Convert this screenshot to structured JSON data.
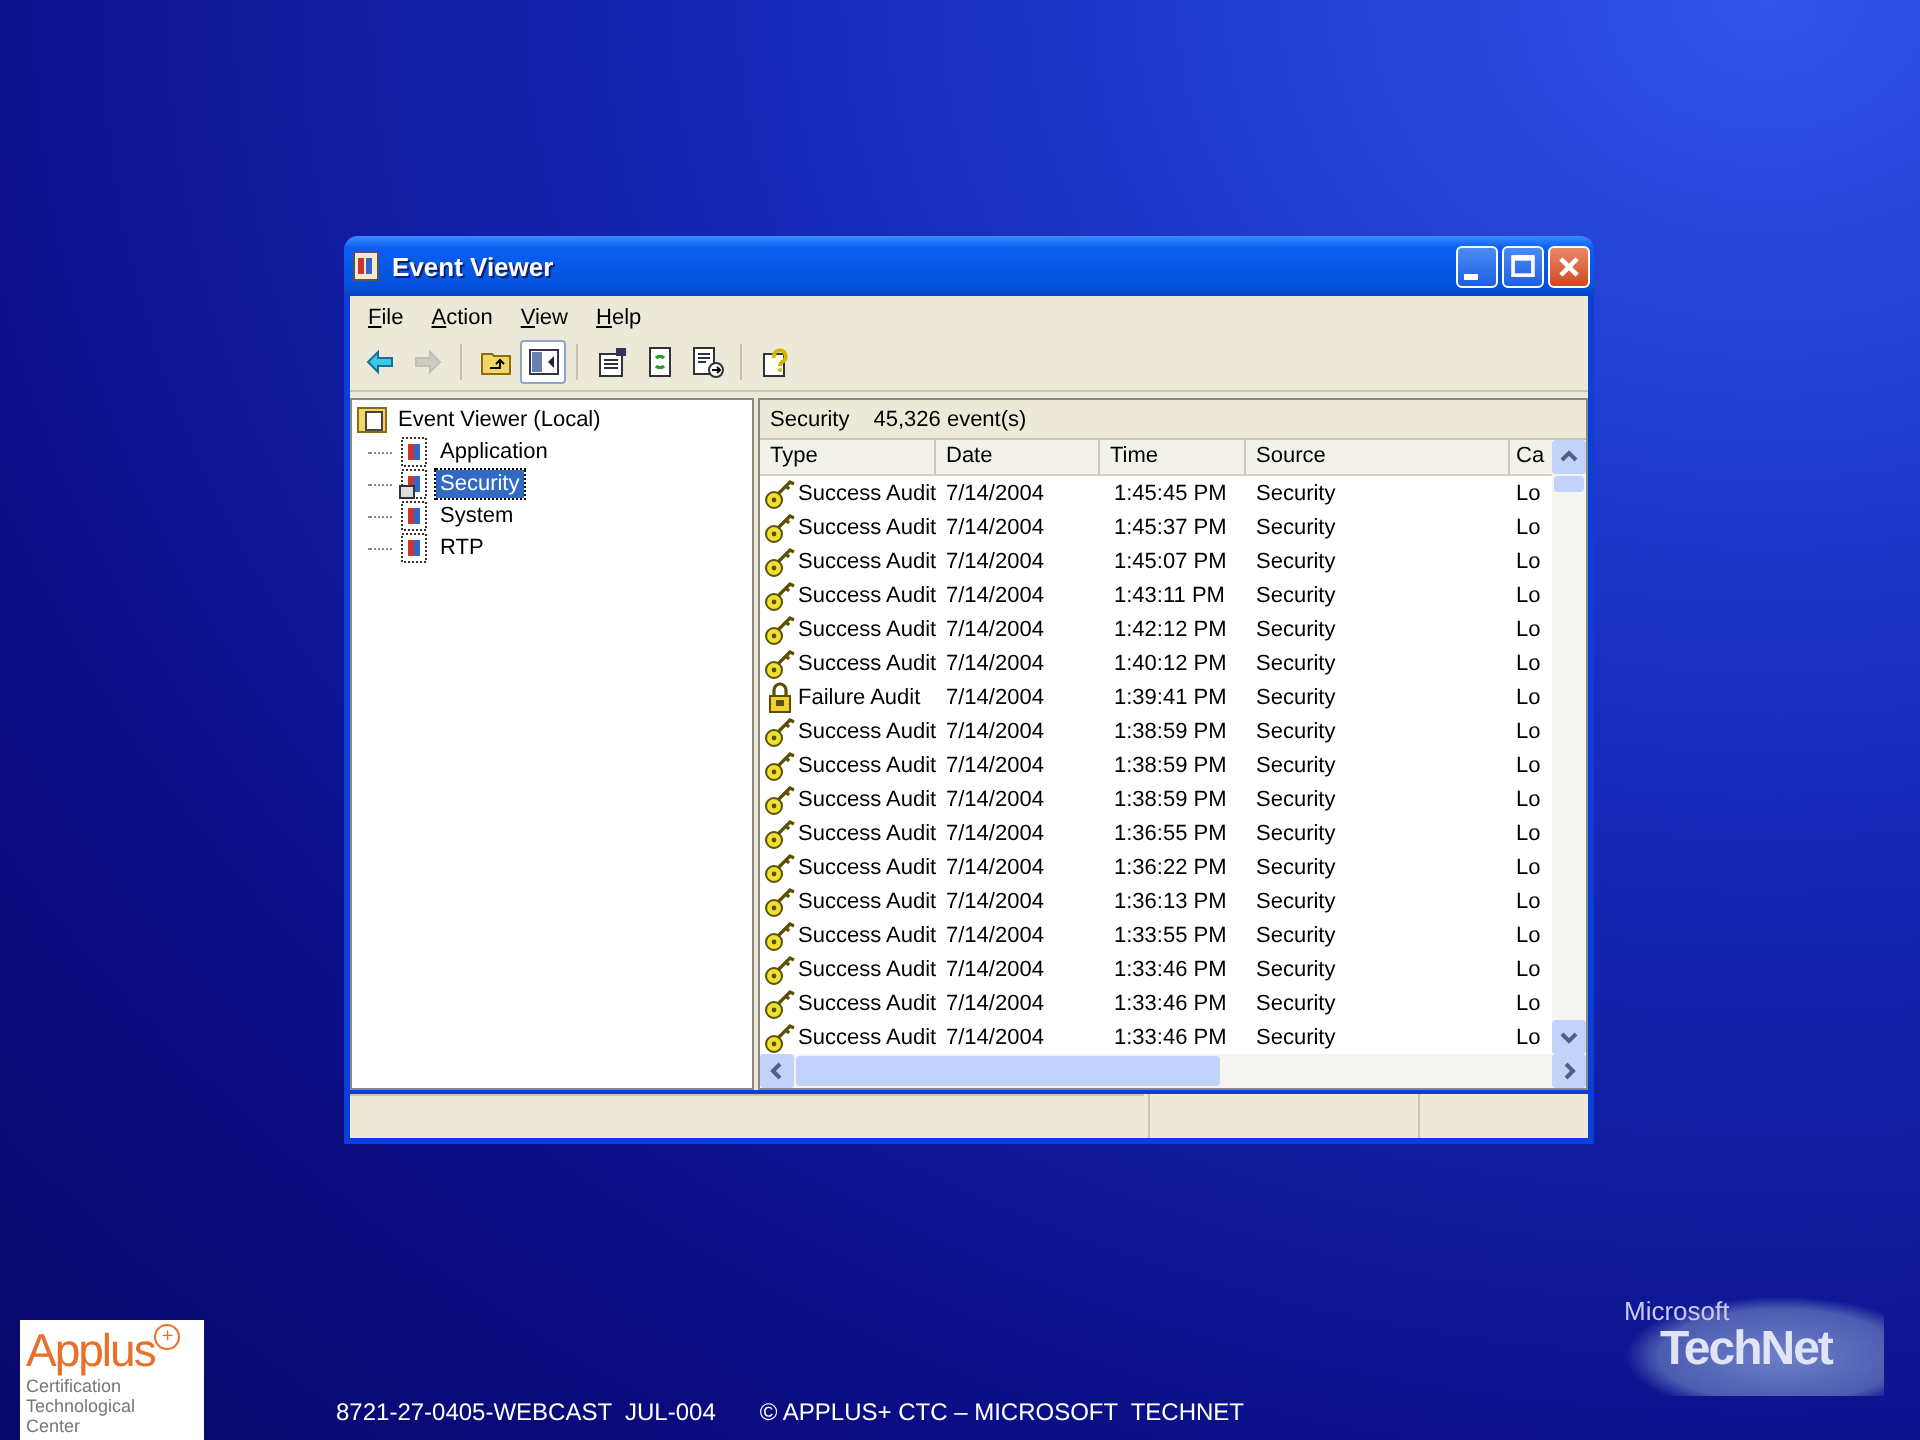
{
  "slide": {
    "footer_code": "8721-27-0405-WEBCAST  JUL-004",
    "footer_copyright": "© APPLUS+ CTC – MICROSOFT  TECHNET",
    "left_logo": {
      "name": "Applus",
      "plus": "+",
      "caption": "Certification Technological Center"
    },
    "right_logo": {
      "top": "Microsoft",
      "bottom": "TechNet"
    }
  },
  "window": {
    "title": "Event Viewer",
    "menu": [
      "File",
      "Action",
      "View",
      "Help"
    ],
    "toolbar": [
      {
        "kind": "back",
        "disabled": false,
        "pressed": false
      },
      {
        "kind": "forward",
        "disabled": true,
        "pressed": false
      },
      {
        "kind": "separator"
      },
      {
        "kind": "up",
        "disabled": false,
        "pressed": false
      },
      {
        "kind": "tree",
        "disabled": false,
        "pressed": true
      },
      {
        "kind": "separator"
      },
      {
        "kind": "properties",
        "disabled": false,
        "pressed": false
      },
      {
        "kind": "refresh",
        "disabled": false,
        "pressed": false
      },
      {
        "kind": "export",
        "disabled": false,
        "pressed": false
      },
      {
        "kind": "separator"
      },
      {
        "kind": "help",
        "disabled": false,
        "pressed": false
      }
    ],
    "tree": {
      "label": "Event Viewer (Local)",
      "expanded": true,
      "children": [
        {
          "label": "Application",
          "selected": false
        },
        {
          "label": "Security",
          "selected": true
        },
        {
          "label": "System",
          "selected": false
        },
        {
          "label": "RTP",
          "selected": false
        }
      ]
    },
    "list_header": {
      "log": "Security",
      "count": "45,326 event(s)"
    },
    "table": {
      "columns": [
        "Type",
        "Date",
        "Time",
        "Source",
        "Ca"
      ],
      "rows": [
        {
          "kind": "success",
          "type": "Success Audit",
          "date": "7/14/2004",
          "time": "1:45:45 PM",
          "source": "Security",
          "category": "Lo"
        },
        {
          "kind": "success",
          "type": "Success Audit",
          "date": "7/14/2004",
          "time": "1:45:37 PM",
          "source": "Security",
          "category": "Lo"
        },
        {
          "kind": "success",
          "type": "Success Audit",
          "date": "7/14/2004",
          "time": "1:45:07 PM",
          "source": "Security",
          "category": "Lo"
        },
        {
          "kind": "success",
          "type": "Success Audit",
          "date": "7/14/2004",
          "time": "1:43:11 PM",
          "source": "Security",
          "category": "Lo"
        },
        {
          "kind": "success",
          "type": "Success Audit",
          "date": "7/14/2004",
          "time": "1:42:12 PM",
          "source": "Security",
          "category": "Lo"
        },
        {
          "kind": "success",
          "type": "Success Audit",
          "date": "7/14/2004",
          "time": "1:40:12 PM",
          "source": "Security",
          "category": "Lo"
        },
        {
          "kind": "failure",
          "type": "Failure Audit",
          "date": "7/14/2004",
          "time": "1:39:41 PM",
          "source": "Security",
          "category": "Lo"
        },
        {
          "kind": "success",
          "type": "Success Audit",
          "date": "7/14/2004",
          "time": "1:38:59 PM",
          "source": "Security",
          "category": "Lo"
        },
        {
          "kind": "success",
          "type": "Success Audit",
          "date": "7/14/2004",
          "time": "1:38:59 PM",
          "source": "Security",
          "category": "Lo"
        },
        {
          "kind": "success",
          "type": "Success Audit",
          "date": "7/14/2004",
          "time": "1:38:59 PM",
          "source": "Security",
          "category": "Lo"
        },
        {
          "kind": "success",
          "type": "Success Audit",
          "date": "7/14/2004",
          "time": "1:36:55 PM",
          "source": "Security",
          "category": "Lo"
        },
        {
          "kind": "success",
          "type": "Success Audit",
          "date": "7/14/2004",
          "time": "1:36:22 PM",
          "source": "Security",
          "category": "Lo"
        },
        {
          "kind": "success",
          "type": "Success Audit",
          "date": "7/14/2004",
          "time": "1:36:13 PM",
          "source": "Security",
          "category": "Lo"
        },
        {
          "kind": "success",
          "type": "Success Audit",
          "date": "7/14/2004",
          "time": "1:33:55 PM",
          "source": "Security",
          "category": "Lo"
        },
        {
          "kind": "success",
          "type": "Success Audit",
          "date": "7/14/2004",
          "time": "1:33:46 PM",
          "source": "Security",
          "category": "Lo"
        },
        {
          "kind": "success",
          "type": "Success Audit",
          "date": "7/14/2004",
          "time": "1:33:46 PM",
          "source": "Security",
          "category": "Lo"
        },
        {
          "kind": "success",
          "type": "Success Audit",
          "date": "7/14/2004",
          "time": "1:33:46 PM",
          "source": "Security",
          "category": "Lo"
        }
      ]
    }
  }
}
